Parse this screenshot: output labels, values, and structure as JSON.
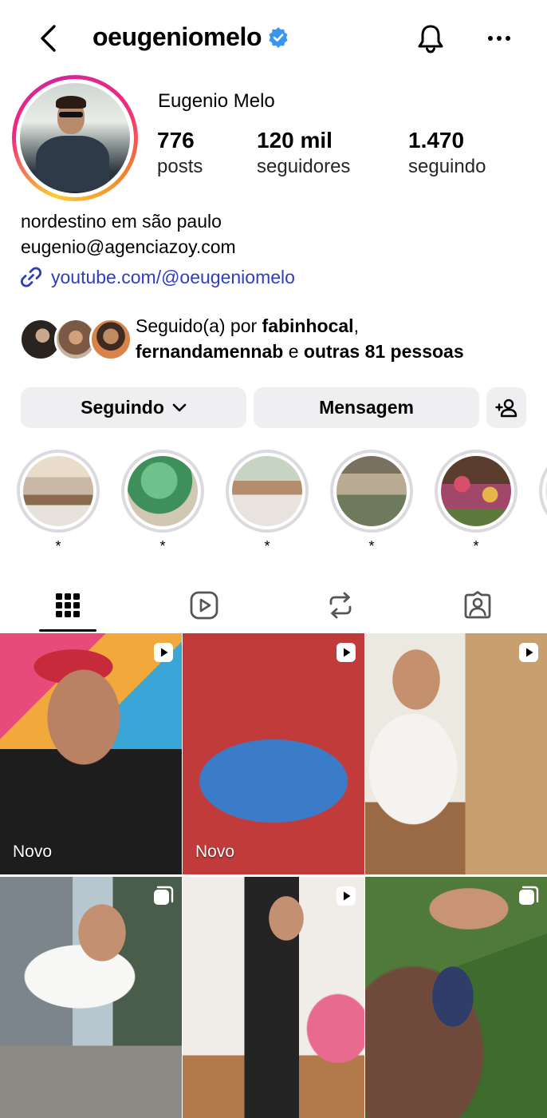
{
  "header": {
    "handle": "oeugeniomelo",
    "verified": true,
    "icons": {
      "back": "chevron-left-icon",
      "verified": "verified-badge-icon",
      "notifications": "bell-icon",
      "more": "more-horizontal-icon"
    }
  },
  "profile": {
    "name": "Eugenio Melo",
    "stats": [
      {
        "value": "776",
        "label": "posts"
      },
      {
        "value": "120 mil",
        "label": "seguidores"
      },
      {
        "value": "1.470",
        "label": "seguindo"
      }
    ],
    "bio_lines": [
      "nordestino em são paulo",
      "eugenio@agenciazoy.com"
    ],
    "link": "youtube.com/@oeugeniomelo",
    "link_icon": "link-icon"
  },
  "followed_by": {
    "prefix": "Seguido(a) por ",
    "user1": "fabinhocal",
    "separator": ",",
    "user2": "fernandamennab",
    "conjunction": " e ",
    "others": "outras 81 pessoas"
  },
  "actions": {
    "following_label": "Seguindo",
    "message_label": "Mensagem",
    "following_icon": "chevron-down-icon",
    "add_user_icon": "add-user-icon"
  },
  "highlights": [
    {
      "label": "*"
    },
    {
      "label": "*"
    },
    {
      "label": "*"
    },
    {
      "label": "*"
    },
    {
      "label": "*"
    }
  ],
  "tabs": [
    {
      "name": "posts-grid",
      "icon": "grid-icon",
      "active": true
    },
    {
      "name": "reels",
      "icon": "reels-icon",
      "active": false
    },
    {
      "name": "reposts",
      "icon": "repost-icon",
      "active": false
    },
    {
      "name": "tagged",
      "icon": "tagged-user-icon",
      "active": false
    }
  ],
  "posts": [
    {
      "type": "reel",
      "new_label": "Novo"
    },
    {
      "type": "reel",
      "new_label": "Novo"
    },
    {
      "type": "reel",
      "new_label": ""
    },
    {
      "type": "carousel",
      "new_label": ""
    },
    {
      "type": "reel",
      "new_label": ""
    },
    {
      "type": "carousel",
      "new_label": ""
    }
  ],
  "colors": {
    "link": "#2f3dbf",
    "verified": "#3897f0",
    "button_bg": "#efeff1"
  }
}
